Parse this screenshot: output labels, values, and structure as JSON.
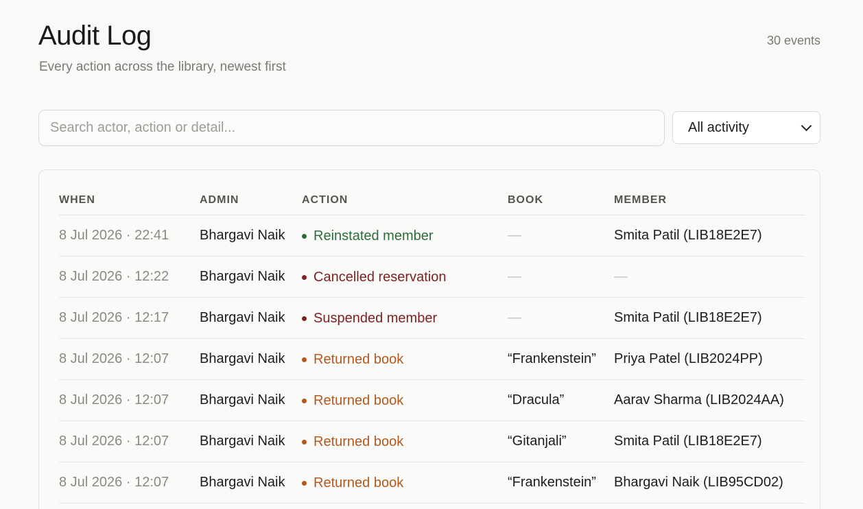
{
  "header": {
    "title": "Audit Log",
    "subtitle": "Every action across the library, newest first",
    "event_count": "30 events"
  },
  "filters": {
    "search_placeholder": "Search actor, action or detail...",
    "search_value": "",
    "activity_selected": "All activity"
  },
  "table": {
    "columns": [
      "WHEN",
      "ADMIN",
      "ACTION",
      "BOOK",
      "MEMBER"
    ],
    "rows": [
      {
        "when": "8 Jul 2026 · 22:41",
        "admin": "Bhargavi Naik",
        "action": "Reinstated member",
        "action_color": "#2e6b3c",
        "book": "—",
        "member": "Smita Patil (LIB18E2E7)"
      },
      {
        "when": "8 Jul 2026 · 12:22",
        "admin": "Bhargavi Naik",
        "action": "Cancelled reservation",
        "action_color": "#7c2222",
        "book": "—",
        "member": "—"
      },
      {
        "when": "8 Jul 2026 · 12:17",
        "admin": "Bhargavi Naik",
        "action": "Suspended member",
        "action_color": "#7c2222",
        "book": "—",
        "member": "Smita Patil (LIB18E2E7)"
      },
      {
        "when": "8 Jul 2026 · 12:07",
        "admin": "Bhargavi Naik",
        "action": "Returned book",
        "action_color": "#b5581c",
        "book": "“Frankenstein”",
        "member": "Priya Patel (LIB2024PP)"
      },
      {
        "when": "8 Jul 2026 · 12:07",
        "admin": "Bhargavi Naik",
        "action": "Returned book",
        "action_color": "#b5581c",
        "book": "“Dracula”",
        "member": "Aarav Sharma (LIB2024AA)"
      },
      {
        "when": "8 Jul 2026 · 12:07",
        "admin": "Bhargavi Naik",
        "action": "Returned book",
        "action_color": "#b5581c",
        "book": "“Gitanjali”",
        "member": "Smita Patil (LIB18E2E7)"
      },
      {
        "when": "8 Jul 2026 · 12:07",
        "admin": "Bhargavi Naik",
        "action": "Returned book",
        "action_color": "#b5581c",
        "book": "“Frankenstein”",
        "member": "Bhargavi Naik (LIB95CD02)"
      }
    ]
  }
}
